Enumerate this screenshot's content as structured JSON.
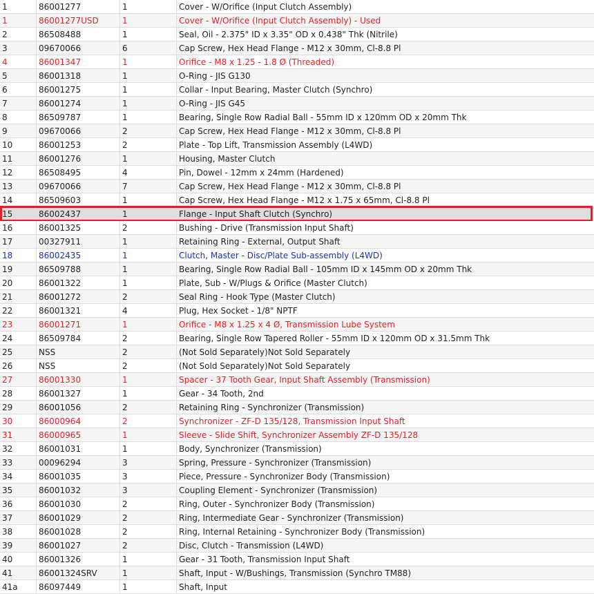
{
  "colors": {
    "red_text": "#e3202a",
    "blue_text": "#1a31b8",
    "highlight_border": "#e3202a"
  },
  "rows": [
    {
      "item": "1",
      "part": "86001277",
      "qty": "1",
      "desc": "Cover - W/Orifice (Input Clutch Assembly)",
      "style": ""
    },
    {
      "item": "1",
      "part": "86001277USD",
      "qty": "1",
      "desc": "Cover - W/Orifice (Input Clutch Assembly) - Used",
      "style": "red"
    },
    {
      "item": "2",
      "part": "86508488",
      "qty": "1",
      "desc": "Seal, Oil - 2.375\" ID x 3.35\" OD x 0.438\" Thk (Nitrile)",
      "style": ""
    },
    {
      "item": "3",
      "part": "09670066",
      "qty": "6",
      "desc": "Cap Screw, Hex Head Flange - M12 x 30mm, Cl-8.8 Pl",
      "style": ""
    },
    {
      "item": "4",
      "part": "86001347",
      "qty": "1",
      "desc": "Orifice - M8 x 1.25 - 1.8 Ø (Threaded)",
      "style": "red"
    },
    {
      "item": "5",
      "part": "86001318",
      "qty": "1",
      "desc": "O-Ring - JIS G130",
      "style": ""
    },
    {
      "item": "6",
      "part": "86001275",
      "qty": "1",
      "desc": "Collar - Input Bearing, Master Clutch (Synchro)",
      "style": ""
    },
    {
      "item": "7",
      "part": "86001274",
      "qty": "1",
      "desc": "O-Ring - JIS G45",
      "style": ""
    },
    {
      "item": "8",
      "part": "86509787",
      "qty": "1",
      "desc": "Bearing, Single Row Radial Ball - 55mm ID x 120mm OD x 20mm Thk",
      "style": ""
    },
    {
      "item": "9",
      "part": "09670066",
      "qty": "2",
      "desc": "Cap Screw, Hex Head Flange - M12 x 30mm, Cl-8.8 Pl",
      "style": ""
    },
    {
      "item": "10",
      "part": "86001253",
      "qty": "2",
      "desc": "Plate - Top Lift, Transmission Assembly (L4WD)",
      "style": ""
    },
    {
      "item": "11",
      "part": "86001276",
      "qty": "1",
      "desc": "Housing, Master Clutch",
      "style": ""
    },
    {
      "item": "12",
      "part": "86508495",
      "qty": "4",
      "desc": "Pin, Dowel - 12mm x 24mm (Hardened)",
      "style": ""
    },
    {
      "item": "13",
      "part": "09670066",
      "qty": "7",
      "desc": "Cap Screw, Hex Head Flange - M12 x 30mm, Cl-8.8 Pl",
      "style": ""
    },
    {
      "item": "14",
      "part": "86509603",
      "qty": "1",
      "desc": "Cap Screw, Hex Head Flange - M12 x 1.75 x 65mm, Cl-8.8 Pl",
      "style": ""
    },
    {
      "item": "15",
      "part": "86002437",
      "qty": "1",
      "desc": "Flange - Input Shaft Clutch (Synchro)",
      "style": "selected"
    },
    {
      "item": "16",
      "part": "86001325",
      "qty": "2",
      "desc": "Bushing - Drive (Transmission Input Shaft)",
      "style": ""
    },
    {
      "item": "17",
      "part": "00327911",
      "qty": "1",
      "desc": "Retaining Ring - External, Output Shaft",
      "style": ""
    },
    {
      "item": "18",
      "part": "86002435",
      "qty": "1",
      "desc": "Clutch, Master - Disc/Plate Sub-assembly (L4WD)",
      "style": "blue"
    },
    {
      "item": "19",
      "part": "86509788",
      "qty": "1",
      "desc": "Bearing, Single Row Radial Ball - 105mm ID x 145mm OD x 20mm Thk",
      "style": ""
    },
    {
      "item": "20",
      "part": "86001322",
      "qty": "1",
      "desc": "Plate, Sub - W/Plugs & Orifice (Master Clutch)",
      "style": ""
    },
    {
      "item": "21",
      "part": "86001272",
      "qty": "2",
      "desc": "Seal Ring - Hook Type (Master Clutch)",
      "style": ""
    },
    {
      "item": "22",
      "part": "86001321",
      "qty": "4",
      "desc": "Plug, Hex Socket - 1/8\" NPTF",
      "style": ""
    },
    {
      "item": "23",
      "part": "86001271",
      "qty": "1",
      "desc": "Orifice - M8 x 1.25 x 4 Ø, Transmission Lube System",
      "style": "red"
    },
    {
      "item": "24",
      "part": "86509784",
      "qty": "2",
      "desc": "Bearing, Single Row Tapered Roller - 55mm ID x 120mm OD x 31.5mm Thk",
      "style": ""
    },
    {
      "item": "25",
      "part": "NSS",
      "qty": "2",
      "desc": "(Not Sold Separately)Not Sold Separately",
      "style": ""
    },
    {
      "item": "26",
      "part": "NSS",
      "qty": "2",
      "desc": "(Not Sold Separately)Not Sold Separately",
      "style": ""
    },
    {
      "item": "27",
      "part": "86001330",
      "qty": "1",
      "desc": "Spacer - 37 Tooth Gear, Input Shaft Assembly (Transmission)",
      "style": "red"
    },
    {
      "item": "28",
      "part": "86001327",
      "qty": "1",
      "desc": "Gear - 34 Tooth, 2nd",
      "style": ""
    },
    {
      "item": "29",
      "part": "86001056",
      "qty": "2",
      "desc": "Retaining Ring - Synchronizer (Transmission)",
      "style": ""
    },
    {
      "item": "30",
      "part": "86000964",
      "qty": "2",
      "desc": "Synchronizer - ZF-D 135/128, Transmission Input Shaft",
      "style": "red"
    },
    {
      "item": "31",
      "part": "86000965",
      "qty": "1",
      "desc": "Sleeve - Slide Shift, Synchronizer Assembly ZF-D 135/128",
      "style": "red"
    },
    {
      "item": "32",
      "part": "86001031",
      "qty": "1",
      "desc": "Body, Synchronizer (Transmission)",
      "style": ""
    },
    {
      "item": "33",
      "part": "00096294",
      "qty": "3",
      "desc": "Spring, Pressure - Synchronizer (Transmission)",
      "style": ""
    },
    {
      "item": "34",
      "part": "86001035",
      "qty": "3",
      "desc": "Piece, Pressure - Synchronizer Body (Transmission)",
      "style": ""
    },
    {
      "item": "35",
      "part": "86001032",
      "qty": "3",
      "desc": "Coupling Element - Synchronizer (Transmission)",
      "style": ""
    },
    {
      "item": "36",
      "part": "86001030",
      "qty": "2",
      "desc": "Ring, Outer - Synchronizer Body (Transmission)",
      "style": ""
    },
    {
      "item": "37",
      "part": "86001029",
      "qty": "2",
      "desc": "Ring, Intermediate Gear - Synchronizer (Transmission)",
      "style": ""
    },
    {
      "item": "38",
      "part": "86001028",
      "qty": "2",
      "desc": "Ring, Internal Retaining - Synchronizer Body (Transmission)",
      "style": ""
    },
    {
      "item": "39",
      "part": "86001027",
      "qty": "2",
      "desc": "Disc, Clutch - Transmission (L4WD)",
      "style": ""
    },
    {
      "item": "40",
      "part": "86001326",
      "qty": "1",
      "desc": "Gear - 31 Tooth, Transmission Input Shaft",
      "style": ""
    },
    {
      "item": "41",
      "part": "86001324SRV",
      "qty": "1",
      "desc": "Shaft, Input - W/Bushings, Transmission (Synchro TM88)",
      "style": ""
    },
    {
      "item": "41a",
      "part": "86097449",
      "qty": "1",
      "desc": "Shaft, Input",
      "style": ""
    }
  ]
}
